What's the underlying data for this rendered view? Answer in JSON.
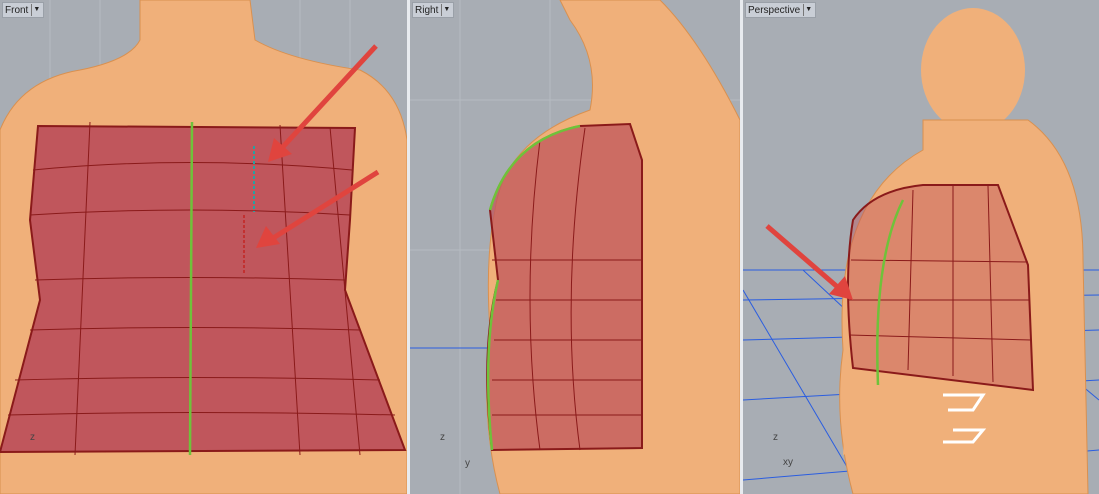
{
  "viewports": [
    {
      "name": "Front",
      "axes": {
        "vertical": "z",
        "horizontal": ""
      }
    },
    {
      "name": "Right",
      "axes": {
        "vertical": "z",
        "horizontal": "y"
      }
    },
    {
      "name": "Perspective",
      "axes": {
        "vertical": "z",
        "horizontal": "xy"
      }
    }
  ],
  "colors": {
    "background": "#a8adb4",
    "body_mesh": "#f0b07a",
    "surface": "#c0565c",
    "seam": "#6fc23a",
    "arrow": "#e0443e",
    "grid_persp": "#2a5de0"
  }
}
